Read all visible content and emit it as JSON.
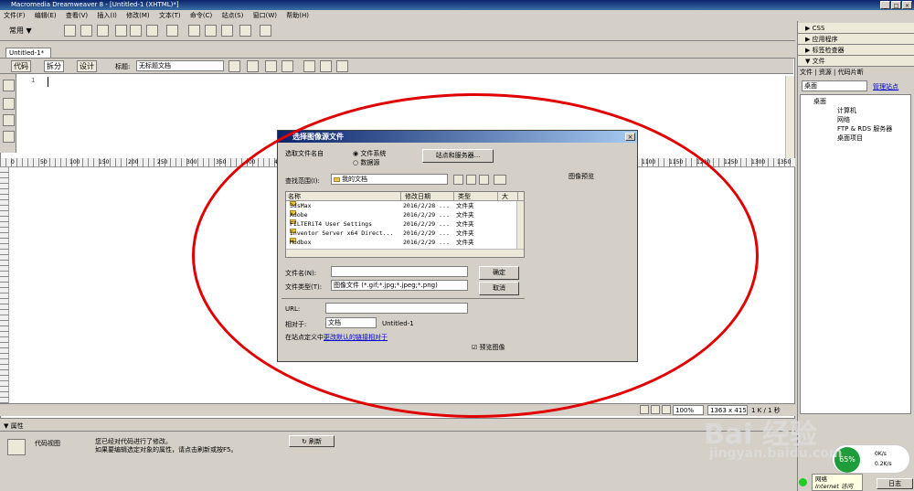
{
  "window": {
    "title": "Macromedia Dreamweaver 8 - [Untitled-1 (XHTML)*]"
  },
  "menu": [
    "文件(F)",
    "编辑(E)",
    "查看(V)",
    "插入(I)",
    "修改(M)",
    "文本(T)",
    "命令(C)",
    "站点(S)",
    "窗口(W)",
    "帮助(H)"
  ],
  "toolbar": {
    "category": "常用"
  },
  "document": {
    "tab": "Untitled-1*",
    "view_code": "代码",
    "view_split": "拆分",
    "view_design": "设计",
    "title_label": "标题:",
    "title_value": "无标题文档",
    "line_number": "1"
  },
  "ruler": {
    "ticks": [
      "0",
      "50",
      "100",
      "150",
      "200",
      "250",
      "300",
      "350",
      "400",
      "450",
      "1100",
      "1150",
      "1200",
      "1250",
      "1300",
      "1350"
    ]
  },
  "status": {
    "zoom": "100%",
    "size": "1363 x 415",
    "kb": "1 K / 1 秒"
  },
  "properties": {
    "header": "属性",
    "code_view": "代码视图",
    "message_line1": "您已经对代码进行了修改。",
    "message_line2": "如果要编辑选定对象的属性，请点击刷新或按F5。",
    "refresh": "刷新"
  },
  "panels": {
    "css": "CSS",
    "app": "应用程序",
    "tag_inspector": "标签检查器",
    "files": "文件",
    "tabs": [
      "文件",
      "资源",
      "代码片断"
    ],
    "location": "桌面",
    "manage_sites": "管理站点",
    "tree": [
      "桌面",
      "计算机",
      "网络",
      "FTP & RDS 服务器",
      "桌面项目"
    ],
    "log": "日志"
  },
  "dialog": {
    "title": "选择图像源文件",
    "select_from": "选取文件名自",
    "radio_fs": "文件系统",
    "radio_ds": "数据源",
    "sites_button": "站点和服务器...",
    "look_in_label": "查找范围(I):",
    "look_in_value": "我的文档",
    "preview_label": "图像预览",
    "columns": [
      "名称",
      "修改日期",
      "类型",
      "大"
    ],
    "files": [
      {
        "name": "3dsMax",
        "date": "2016/2/28 ...",
        "type": "文件夹"
      },
      {
        "name": "Adobe",
        "date": "2016/2/29 ...",
        "type": "文件夹"
      },
      {
        "name": "FILTERiT4 User Settings",
        "date": "2016/2/29 ...",
        "type": "文件夹"
      },
      {
        "name": "Inventor Server x64 Direct...",
        "date": "2016/2/29 ...",
        "type": "文件夹"
      },
      {
        "name": "Mudbox",
        "date": "2016/2/29 ...",
        "type": "文件夹"
      }
    ],
    "filename_label": "文件名(N):",
    "filetype_label": "文件类型(T):",
    "filetype_value": "图像文件 (*.gif;*.jpg;*.jpeg;*.png)",
    "ok": "确定",
    "cancel": "取消",
    "url_label": "URL:",
    "relative_label": "相对于:",
    "relative_value": "文档",
    "relative_doc": "Untitled-1",
    "site_def_prefix": "在站点定义中",
    "site_def_link": "更改默认的链接相对于",
    "preview_images": "预览图像"
  },
  "overlay": {
    "speed_percent": "65%",
    "up": "0K/s",
    "down": "0.2K/s",
    "network": "网络",
    "internet": "Internet 访问"
  },
  "watermark": {
    "brand": "Bai 经验",
    "url": "jingyan.baidu.com"
  },
  "colors": {
    "annotation": "#e00000",
    "title_bar": "#0a246a"
  }
}
